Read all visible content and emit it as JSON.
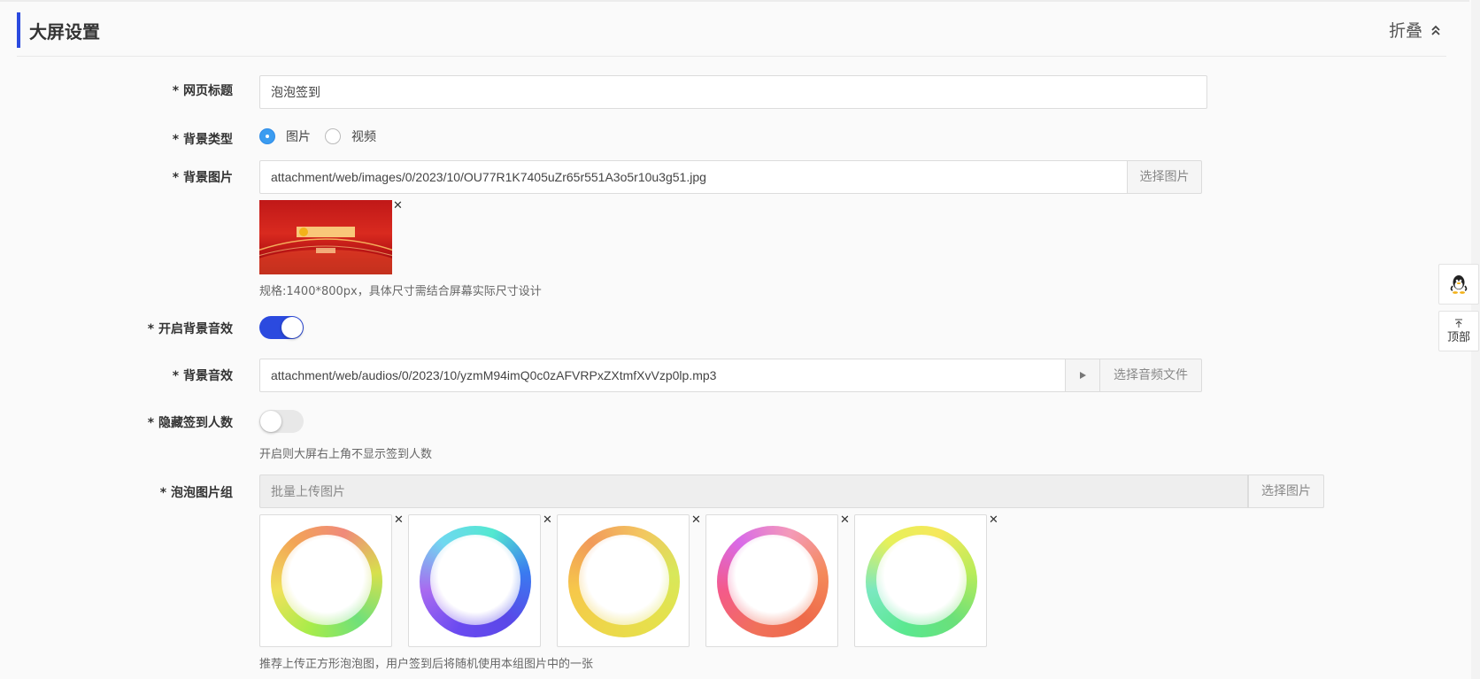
{
  "section": {
    "title": "大屏设置",
    "collapse_label": "折叠"
  },
  "fields": {
    "page_title": {
      "label": "* 网页标题",
      "value": "泡泡签到"
    },
    "bg_type": {
      "label": "* 背景类型",
      "options": [
        "图片",
        "视频"
      ],
      "selected": "图片"
    },
    "bg_image": {
      "label": "* 背景图片",
      "value": "attachment/web/images/0/2023/10/OU77R1K7405uZr65r551A3o5r10u3g51.jpg",
      "button": "选择图片",
      "hint": "规格:1400*800px，具体尺寸需结合屏幕实际尺寸设计"
    },
    "bg_audio_enabled": {
      "label": "* 开启背景音效",
      "on": true
    },
    "bg_audio": {
      "label": "* 背景音效",
      "value": "attachment/web/audios/0/2023/10/yzmM94imQ0c0zAFVRPxZXtmfXvVzp0lp.mp3",
      "button": "选择音频文件"
    },
    "hide_count": {
      "label": "* 隐藏签到人数",
      "on": false,
      "hint": "开启则大屏右上角不显示签到人数"
    },
    "bubble_images": {
      "label": "* 泡泡图片组",
      "placeholder": "批量上传图片",
      "button": "选择图片",
      "hint": "推荐上传正方形泡泡图，用户签到后将随机使用本组图片中的一张",
      "bubbles": [
        "green-orange",
        "blue-purple",
        "yellow-orange",
        "pink-red",
        "green-yellow"
      ]
    }
  },
  "side": {
    "top_label": "顶部"
  },
  "colors": {
    "accent": "#2b4adf",
    "radio": "#3b9cf0"
  }
}
